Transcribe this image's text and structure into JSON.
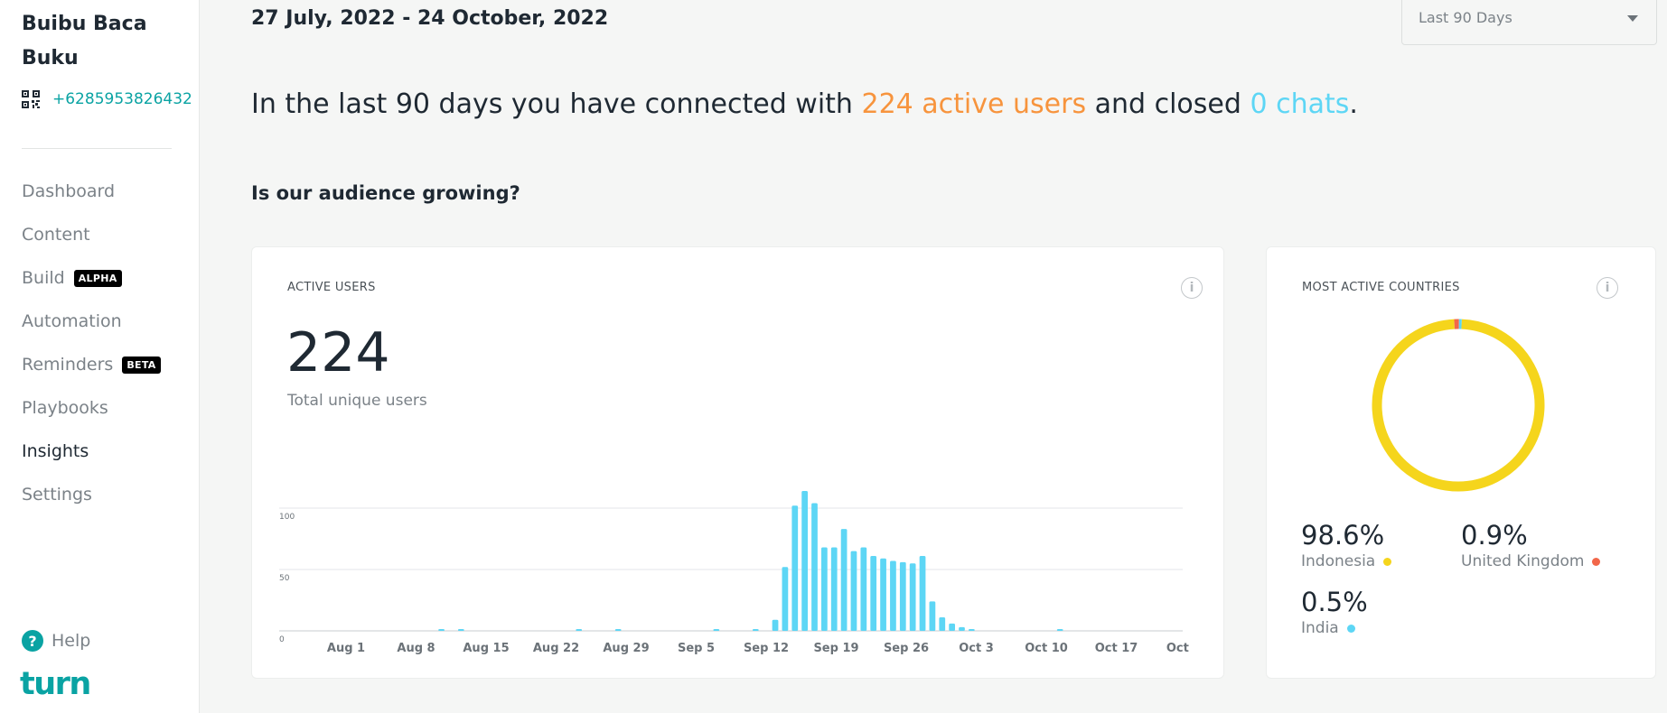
{
  "sidebar": {
    "org_name": "Buibu Baca Buku",
    "phone": "+6285953826432",
    "nav": [
      {
        "label": "Dashboard",
        "badge": ""
      },
      {
        "label": "Content",
        "badge": ""
      },
      {
        "label": "Build",
        "badge": "ALPHA"
      },
      {
        "label": "Automation",
        "badge": ""
      },
      {
        "label": "Reminders",
        "badge": "BETA"
      },
      {
        "label": "Playbooks",
        "badge": ""
      },
      {
        "label": "Insights",
        "badge": ""
      },
      {
        "label": "Settings",
        "badge": ""
      }
    ],
    "active_item": "Insights",
    "help_label": "Help",
    "logo_text": "turn"
  },
  "header": {
    "date_range": "27 July, 2022 - 24 October, 2022",
    "period_select": "Last 90 Days"
  },
  "summary": {
    "prefix": "In the last 90 days you have connected with ",
    "users": "224 active users",
    "middle": " and closed ",
    "chats": "0 chats",
    "suffix": "."
  },
  "section_title": "Is our audience growing?",
  "active_users_card": {
    "title": "ACTIVE USERS",
    "total": "224",
    "total_label": "Total unique users"
  },
  "countries_card": {
    "title": "MOST ACTIVE COUNTRIES",
    "items": [
      {
        "pct": "98.6%",
        "country": "Indonesia",
        "color": "#f5d51c"
      },
      {
        "pct": "0.9%",
        "country": "United Kingdom",
        "color": "#f2674a"
      },
      {
        "pct": "0.5%",
        "country": "India",
        "color": "#5dd6f5"
      }
    ]
  },
  "chart_data": [
    {
      "type": "bar",
      "title": "ACTIVE USERS",
      "x_ticks": [
        "Aug 1",
        "Aug 8",
        "Aug 15",
        "Aug 22",
        "Aug 29",
        "Sep 5",
        "Sep 12",
        "Sep 19",
        "Sep 26",
        "Oct 3",
        "Oct 10",
        "Oct 17",
        "Oct ..."
      ],
      "y_ticks": [
        "0",
        "50",
        "100"
      ],
      "ylim": [
        0,
        100
      ],
      "grid": true,
      "color": "#5dd6f5",
      "x_start": "2022-07-27",
      "values": [
        0,
        0,
        0,
        0,
        0,
        0,
        0,
        0,
        0,
        0,
        0,
        0,
        0,
        0,
        1,
        0,
        1,
        0,
        0,
        0,
        0,
        0,
        0,
        0,
        0,
        0,
        0,
        0,
        1,
        0,
        0,
        0,
        1,
        0,
        0,
        0,
        0,
        0,
        0,
        0,
        0,
        0,
        1,
        0,
        0,
        0,
        1,
        0,
        9,
        52,
        102,
        114,
        104,
        68,
        68,
        83,
        65,
        68,
        61,
        59,
        57,
        56,
        55,
        61,
        24,
        11,
        6,
        3,
        1,
        0,
        0,
        0,
        0,
        0,
        0,
        0,
        0,
        1,
        0,
        0,
        0,
        0,
        0,
        0,
        0,
        0,
        0,
        0,
        0,
        0
      ]
    },
    {
      "type": "pie",
      "title": "MOST ACTIVE COUNTRIES",
      "categories": [
        "Indonesia",
        "United Kingdom",
        "India"
      ],
      "values": [
        98.6,
        0.9,
        0.5
      ],
      "colors": [
        "#f5d51c",
        "#f2674a",
        "#5dd6f5"
      ]
    }
  ]
}
